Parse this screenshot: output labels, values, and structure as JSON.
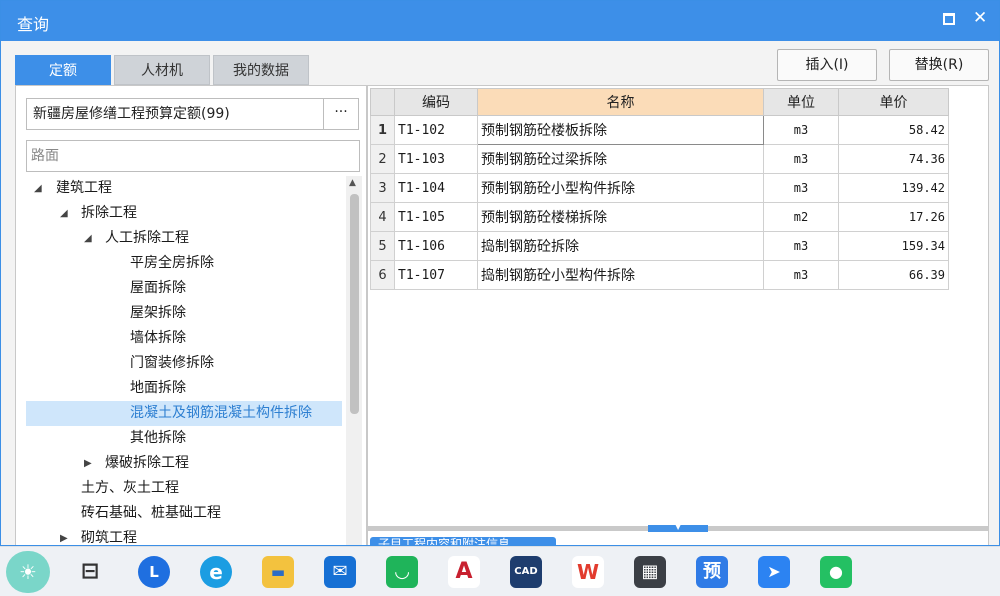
{
  "window": {
    "title": "查询"
  },
  "tabs": [
    {
      "label": "定额",
      "active": true
    },
    {
      "label": "人材机",
      "active": false
    },
    {
      "label": "我的数据",
      "active": false
    }
  ],
  "buttons": {
    "insert": "插入(I)",
    "replace": "替换(R)"
  },
  "quota_select": {
    "value": "新疆房屋修缮工程预算定额(99)",
    "more": "···"
  },
  "search": {
    "value": "路面"
  },
  "tree": [
    {
      "label": "建筑工程",
      "arrow": "◢"
    },
    {
      "label": "拆除工程",
      "arrow": "◢"
    },
    {
      "label": "人工拆除工程",
      "arrow": "◢"
    },
    {
      "label": "平房全房拆除",
      "arrow": ""
    },
    {
      "label": "屋面拆除",
      "arrow": ""
    },
    {
      "label": "屋架拆除",
      "arrow": ""
    },
    {
      "label": "墙体拆除",
      "arrow": ""
    },
    {
      "label": "门窗装修拆除",
      "arrow": ""
    },
    {
      "label": "地面拆除",
      "arrow": ""
    },
    {
      "label": "混凝土及钢筋混凝土构件拆除",
      "arrow": "",
      "selected": true
    },
    {
      "label": "其他拆除",
      "arrow": ""
    },
    {
      "label": "爆破拆除工程",
      "arrow": "▶"
    },
    {
      "label": "土方、灰土工程",
      "arrow": ""
    },
    {
      "label": "砖石基础、桩基础工程",
      "arrow": ""
    },
    {
      "label": "砌筑工程",
      "arrow": "▶"
    }
  ],
  "table": {
    "headers": {
      "code": "编码",
      "name": "名称",
      "unit": "单位",
      "price": "单价"
    },
    "rows": [
      {
        "idx": "1",
        "code": "T1-102",
        "name": "预制钢筋砼楼板拆除",
        "unit": "m3",
        "price": "58.42"
      },
      {
        "idx": "2",
        "code": "T1-103",
        "name": "预制钢筋砼过梁拆除",
        "unit": "m3",
        "price": "74.36"
      },
      {
        "idx": "3",
        "code": "T1-104",
        "name": "预制钢筋砼小型构件拆除",
        "unit": "m3",
        "price": "139.42"
      },
      {
        "idx": "4",
        "code": "T1-105",
        "name": "预制钢筋砼楼梯拆除",
        "unit": "m2",
        "price": "17.26"
      },
      {
        "idx": "5",
        "code": "T1-106",
        "name": "捣制钢筋砼拆除",
        "unit": "m3",
        "price": "159.34"
      },
      {
        "idx": "6",
        "code": "T1-107",
        "name": "捣制钢筋砼小型构件拆除",
        "unit": "m3",
        "price": "66.39"
      }
    ]
  },
  "bottom_tab": {
    "label": "子目工程内容和附注信息"
  },
  "taskbar": {
    "icons": [
      {
        "name": "weather-icon",
        "color": "#f2b640",
        "glyph": "☀"
      },
      {
        "name": "task-view-icon",
        "color": "#eef1f5",
        "glyph": "⊟"
      },
      {
        "name": "lenovo-app-icon",
        "color": "#1f6fe0",
        "glyph": "L"
      },
      {
        "name": "edge-browser-icon",
        "color": "#1b9de2",
        "glyph": "e"
      },
      {
        "name": "file-explorer-icon",
        "color": "#f3c23e",
        "glyph": "▬"
      },
      {
        "name": "mail-icon",
        "color": "#1670d4",
        "glyph": "✉"
      },
      {
        "name": "store-bag-icon",
        "color": "#1fb45a",
        "glyph": "◡"
      },
      {
        "name": "autocad-icon",
        "color": "#c8202f",
        "glyph": "A"
      },
      {
        "name": "cad-viewer-icon",
        "color": "#1e3d6e",
        "glyph": "CAD"
      },
      {
        "name": "wps-office-icon",
        "color": "#e23b2e",
        "glyph": "W"
      },
      {
        "name": "calculator-icon",
        "color": "#3b3f45",
        "glyph": "▦"
      },
      {
        "name": "budget-app-icon",
        "color": "#2f7be6",
        "glyph": "预"
      },
      {
        "name": "dingtalk-icon",
        "color": "#2c83f2",
        "glyph": "➤"
      },
      {
        "name": "wechat-icon",
        "color": "#24c063",
        "glyph": "●"
      }
    ]
  }
}
